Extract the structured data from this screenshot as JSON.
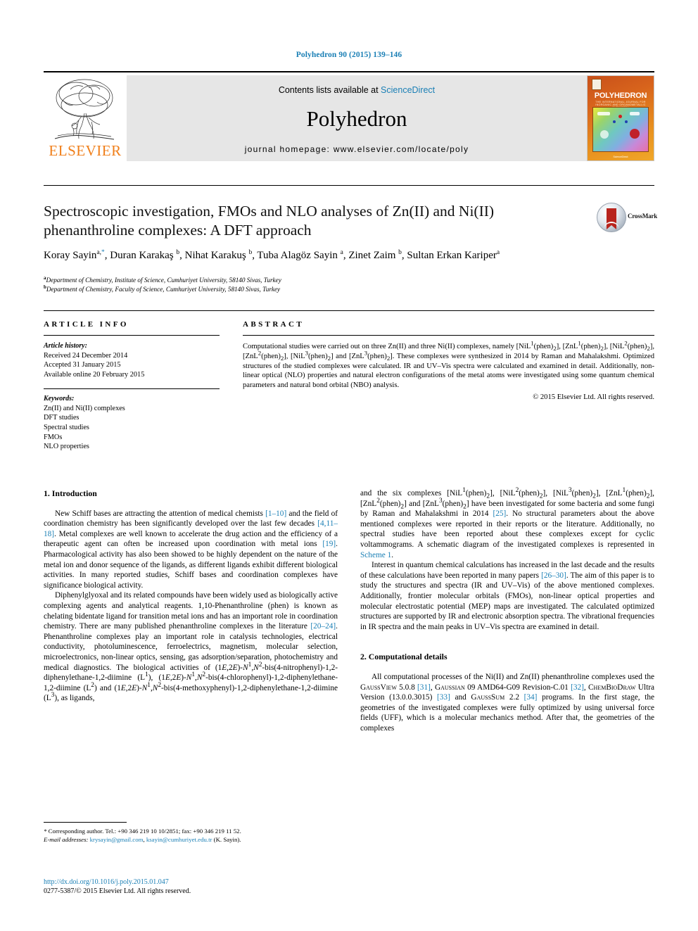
{
  "running_head": "Polyhedron 90 (2015) 139–146",
  "masthead": {
    "contents_prefix": "Contents lists available at ",
    "sciencedirect": "ScienceDirect",
    "journal_name": "Polyhedron",
    "homepage": "journal homepage: www.elsevier.com/locate/poly",
    "publisher": "ELSEVIER",
    "cover": {
      "title": "POLYHEDRON",
      "subtitle": "THE INTERNATIONAL JOURNAL FOR INORGANIC AND ORGANOMETALLIC CHEMISTRY",
      "footer": "ScienceDirect"
    }
  },
  "crossmark": {
    "label": "CrossMark"
  },
  "article": {
    "title": "Spectroscopic investigation, FMOs and NLO analyses of Zn(II) and Ni(II) phenanthroline complexes: A DFT approach",
    "authors_html": "Koray Sayin<sup>a,</sup><sup class=\"star\">*</sup>, Duran Karakaş <sup>b</sup>, Nihat Karakuş <sup>b</sup>, Tuba Alagöz Sayin <sup>a</sup>, Zinet Zaim <sup>b</sup>, Sultan Erkan Kariper<sup>a</sup>",
    "affiliations": [
      {
        "marker": "a",
        "text": "Department of Chemistry, Institute of Science, Cumhuriyet University, 58140 Sivas, Turkey"
      },
      {
        "marker": "b",
        "text": "Department of Chemistry, Faculty of Science, Cumhuriyet University, 58140 Sivas, Turkey"
      }
    ]
  },
  "article_info": {
    "heading": "ARTICLE INFO",
    "history_title": "Article history:",
    "history": [
      "Received 24 December 2014",
      "Accepted 31 January 2015",
      "Available online 20 February 2015"
    ],
    "keywords_title": "Keywords:",
    "keywords": [
      "Zn(II) and Ni(II) complexes",
      "DFT studies",
      "Spectral studies",
      "FMOs",
      "NLO properties"
    ]
  },
  "abstract": {
    "heading": "ABSTRACT",
    "body_html": "Computational studies were carried out on three Zn(II) and three Ni(II) complexes, namely [NiL<sup>1</sup>(phen)<sub>2</sub>], [ZnL<sup>1</sup>(phen)<sub>2</sub>], [NiL<sup>2</sup>(phen)<sub>2</sub>], [ZnL<sup>2</sup>(phen)<sub>2</sub>], [NiL<sup>3</sup>(phen)<sub>2</sub>] and [ZnL<sup>3</sup>(phen)<sub>2</sub>]. These complexes were synthesized in 2014 by Raman and Mahalakshmi. Optimized structures of the studied complexes were calculated. IR and UV–Vis spectra were calculated and examined in detail. Additionally, non-linear optical (NLO) properties and natural electron configurations of the metal atoms were investigated using some quantum chemical parameters and natural bond orbital (NBO) analysis.",
    "copyright": "© 2015 Elsevier Ltd. All rights reserved."
  },
  "body": {
    "section1_heading": "1. Introduction",
    "section1_paragraphs_html": [
      "New Schiff bases are attracting the attention of medical chemists <span class=\"ref\">[1–10]</span> and the field of coordination chemistry has been significantly developed over the last few decades <span class=\"ref\">[4,11–18]</span>. Metal complexes are well known to accelerate the drug action and the efficiency of a therapeutic agent can often be increased upon coordination with metal ions <span class=\"ref\">[19]</span>. Pharmacological activity has also been showed to be highly dependent on the nature of the metal ion and donor sequence of the ligands, as different ligands exhibit different biological activities. In many reported studies, Schiff bases and coordination complexes have significance biological activity.",
      "Diphenylglyoxal and its related compounds have been widely used as biologically active complexing agents and analytical reagents. 1,10-Phenanthroline (phen) is known as chelating bidentate ligand for transition metal ions and has an important role in coordination chemistry. There are many published phenanthroline complexes in the literature <span class=\"ref\">[20–24]</span>. Phenanthroline complexes play an important role in catalysis technologies, electrical conductivity, photoluminescence, ferroelectrics, magnetism, molecular selection, microelectronics, non-linear optics, sensing, gas adsorption/separation, photochemistry and medical diagnostics. The biological activities of (1<i>E</i>,2<i>E</i>)-<i>N</i><sup>1</sup>,<i>N</i><sup>2</sup>-bis(4-nitrophenyl)-1,2-diphenylethane-1,2-diimine (L<sup>1</sup>), (1<i>E</i>,2<i>E</i>)-<i>N</i><sup>1</sup>,<i>N</i><sup>2</sup>-bis(4-chlorophenyl)-1,2-diphenylethane-1,2-diimine (L<sup>2</sup>) and (1<i>E</i>,2<i>E</i>)-<i>N</i><sup>1</sup>,<i>N</i><sup>2</sup>-bis(4-methoxyphenyl)-1,2-diphenylethane-1,2-diimine (L<sup>3</sup>), as ligands,"
    ],
    "right_paragraphs_html": [
      "and the six complexes [NiL<sup>1</sup>(phen)<sub>2</sub>], [NiL<sup>2</sup>(phen)<sub>2</sub>], [NiL<sup>3</sup>(phen)<sub>2</sub>], [ZnL<sup>1</sup>(phen)<sub>2</sub>], [ZnL<sup>2</sup>(phen)<sub>2</sub>] and [ZnL<sup>3</sup>(phen)<sub>2</sub>] have been investigated for some bacteria and some fungi by Raman and Mahalakshmi in 2014 <span class=\"ref\">[25]</span>. No structural parameters about the above mentioned complexes were reported in their reports or the literature. Additionally, no spectral studies have been reported about these complexes except for cyclic voltammograms. A schematic diagram of the investigated complexes is represented in <span class=\"ref\">Scheme 1</span>.",
      "Interest in quantum chemical calculations has increased in the last decade and the results of these calculations have been reported in many papers <span class=\"ref\">[26–30]</span>. The aim of this paper is to study the structures and spectra (IR and UV–Vis) of the above mentioned complexes. Additionally, frontier molecular orbitals (FMOs), non-linear optical properties and molecular electrostatic potential (MEP) maps are investigated. The calculated optimized structures are supported by IR and electronic absorption spectra. The vibrational frequencies in IR spectra and the main peaks in UV–Vis spectra are examined in detail."
    ],
    "section2_heading": "2. Computational details",
    "section2_paragraphs_html": [
      "All computational processes of the Ni(II) and Zn(II) phenanthroline complexes used the <span class=\"smallcaps\">GaussView</span> 5.0.8 <span class=\"ref\">[31]</span>, <span class=\"smallcaps\">Gaussian</span> 09 AMD64-G09 Revision-C.01 <span class=\"ref\">[32]</span>, <span class=\"smallcaps\">ChemBioDraw</span> Ultra Version (13.0.0.3015) <span class=\"ref\">[33]</span> and <span class=\"smallcaps\">GaussSum</span> 2.2 <span class=\"ref\">[34]</span> programs. In the first stage, the geometries of the investigated complexes were fully optimized by using universal force fields (UFF), which is a molecular mechanics method. After that, the geometries of the complexes"
    ]
  },
  "footnote": {
    "corresponding_html": "<span class=\"lbl\">*</span> Corresponding author. Tel.: +90 346 219 10 10/2851; fax: +90 346 219 11 52.",
    "email_html": "<span class=\"lbl\">E-mail addresses:</span> <span class=\"ref\">krysayin@gmail.com</span>, <span class=\"ref\">ksayin@cumhuriyet.edu.tr</span> (K. Sayin)."
  },
  "footer": {
    "doi": "http://dx.doi.org/10.1016/j.poly.2015.01.047",
    "issn": "0277-5387/© 2015 Elsevier Ltd. All rights reserved."
  },
  "colors": {
    "link": "#1a7fb5",
    "elsevier_orange": "#f07f1a",
    "masthead_gray": "#e6e6e6",
    "crossmark_red": "#b8241d"
  }
}
